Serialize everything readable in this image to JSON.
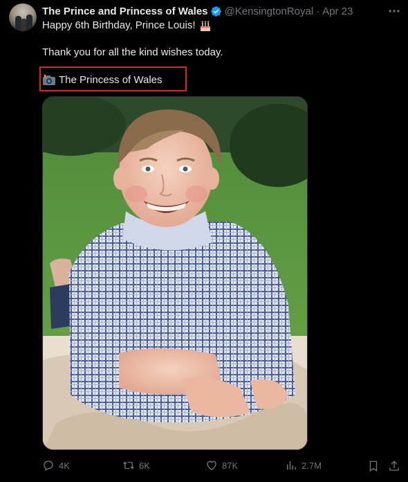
{
  "tweet": {
    "author_name": "The Prince and Princess of Wales",
    "handle": "@KensingtonRoyal",
    "separator": "·",
    "date": "Apr 23",
    "line1": "Happy 6th Birthday, Prince Louis!",
    "line2": "Thank you for all the kind wishes today.",
    "credit": "The Princess of Wales"
  },
  "actions": {
    "replies": "4K",
    "retweets": "6K",
    "likes": "87K",
    "views": "2.7M"
  },
  "colors": {
    "background": "#000000",
    "text": "#e7e9ea",
    "muted": "#71767b",
    "verified": "#1d9bf0",
    "highlight": "#e11d2b"
  },
  "icons": [
    "avatar",
    "verified-badge-icon",
    "more-icon",
    "birthday-cake-icon",
    "camera-flash-icon",
    "reply-icon",
    "retweet-icon",
    "like-icon",
    "views-icon",
    "bookmark-icon",
    "share-icon"
  ]
}
